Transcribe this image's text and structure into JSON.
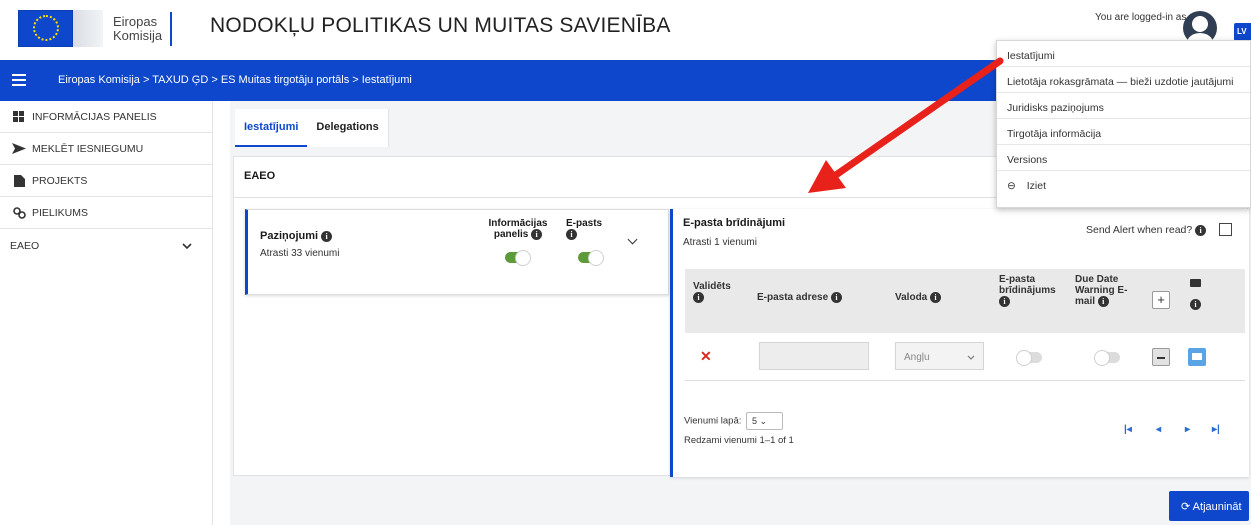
{
  "header": {
    "logo_line1": "Eiropas",
    "logo_line2": "Komisija",
    "site_title": "NODOKĻU POLITIKAS UN MUITAS SAVIENĪBA",
    "logged_in_text": "You are logged-in as",
    "language": "LV"
  },
  "breadcrumb": {
    "text": "Eiropas Komisija > TAXUD ĢD > ES Muitas tirgotāju portāls > Iestatījumi"
  },
  "sidebar": {
    "items": [
      {
        "label": "INFORMĀCIJAS PANELIS",
        "icon": "dashboard-icon"
      },
      {
        "label": "MEKLĒT IESNIEGUMU",
        "icon": "send-arrow-icon"
      },
      {
        "label": "PROJEKTS",
        "icon": "document-icon"
      },
      {
        "label": "PIELIKUMS",
        "icon": "attachment-icon"
      },
      {
        "label": "EAEO",
        "icon": "chevron-down-icon"
      }
    ]
  },
  "tabs": [
    {
      "label": "Iestatījumi",
      "active": true
    },
    {
      "label": "Delegations",
      "active": false
    }
  ],
  "section": {
    "title": "EAEO"
  },
  "notifications": {
    "title": "Paziņojumi",
    "subtitle": "Atrasti 33 vienumi",
    "col_dashboard": "Informācijas panelis",
    "col_email": "E-pasts",
    "dashboard_toggle_on": true,
    "email_toggle_on": true
  },
  "alerts": {
    "title": "E-pasta brīdinājumi",
    "subtitle": "Atrasti 1 vienumi",
    "send_alert_label": "Send Alert when read?",
    "columns": {
      "validated": "Validēts",
      "email_address": "E-pasta adrese",
      "language": "Valoda",
      "email_alerts": "E-pasta brīdinājums",
      "due_date": "Due Date Warning E-mail"
    },
    "row": {
      "language_value": "Angļu",
      "email_value": ""
    },
    "pager": {
      "per_page_label": "Vienumi lapā:",
      "per_page_value": "5",
      "showing": "Redzami vienumi 1–1 of 1"
    }
  },
  "refresh_label": "Atjaunināt",
  "user_menu": {
    "items": [
      "Iestatījumi",
      "Lietotāja rokasgrāmata — bieži uzdotie jautājumi",
      "Juridisks paziņojums",
      "Tirgotāja informācija",
      "Versions",
      "Iziet"
    ]
  },
  "colors": {
    "brand_blue": "#0e47cb",
    "toggle_green": "#5c9a3a",
    "annotation_arrow": "#e8221b"
  }
}
